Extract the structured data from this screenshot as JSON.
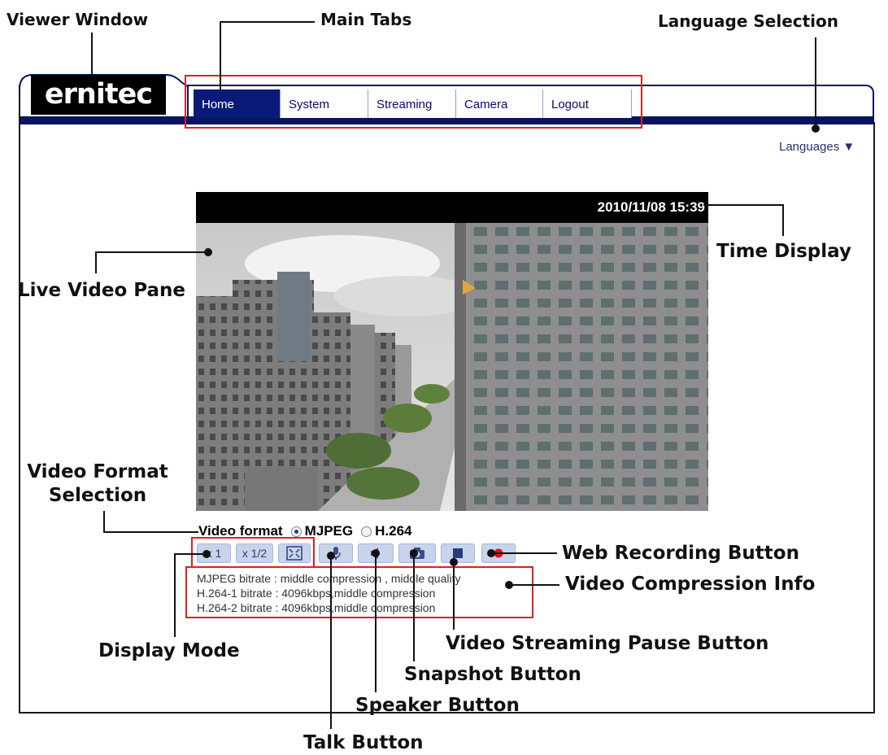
{
  "callouts": {
    "viewer_window": "Viewer Window",
    "main_tabs": "Main Tabs",
    "language_selection": "Language Selection",
    "time_display": "Time Display",
    "live_video_pane": "Live Video Pane",
    "video_format_selection": "Video Format Selection",
    "web_recording_button": "Web Recording Button",
    "video_compression_info": "Video Compression Info",
    "display_mode": "Display Mode",
    "video_streaming_pause_button": "Video Streaming Pause Button",
    "snapshot_button": "Snapshot Button",
    "speaker_button": "Speaker Button",
    "talk_button": "Talk Button"
  },
  "header": {
    "logo": "ernitec",
    "tabs": [
      {
        "label": "Home",
        "active": true
      },
      {
        "label": "System",
        "active": false
      },
      {
        "label": "Streaming",
        "active": false
      },
      {
        "label": "Camera",
        "active": false
      },
      {
        "label": "Logout",
        "active": false
      }
    ],
    "languages_label": "Languages ▼"
  },
  "video": {
    "timestamp": "2010/11/08 15:39",
    "format_label": "Video format",
    "formats": [
      {
        "label": "MJPEG",
        "selected": true
      },
      {
        "label": "H.264",
        "selected": false
      }
    ]
  },
  "controls": {
    "zoom_x1": "x 1",
    "zoom_half": "x 1/2",
    "icons": [
      "fit-icon",
      "microphone-icon",
      "speaker-icon",
      "camera-icon",
      "stop-icon",
      "record-icon"
    ]
  },
  "compression_info": [
    "MJPEG bitrate : middle compression , middle quality",
    "H.264-1 bitrate : 4096kbps,middle compression",
    "H.264-2 bitrate : 4096kbps,middle compression"
  ],
  "colors": {
    "tab_bar": "#07155f",
    "active_tab": "#0a1a78",
    "highlight_box": "#e02020",
    "record_dot": "#dd1010"
  }
}
